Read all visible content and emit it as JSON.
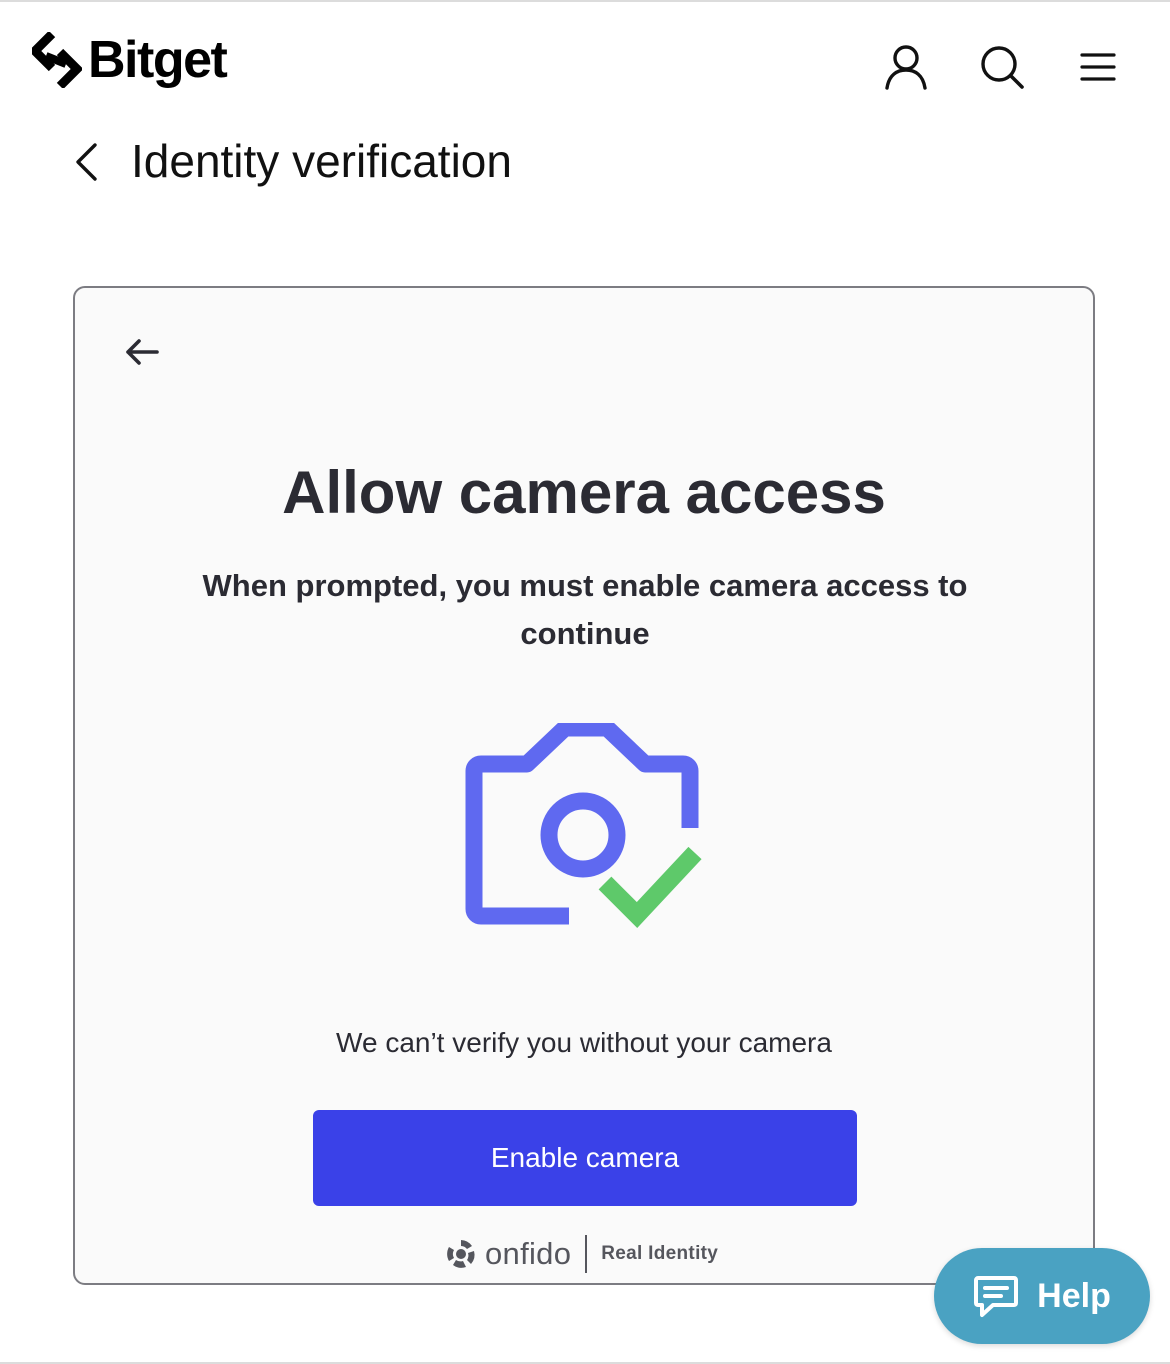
{
  "header": {
    "brand": "Bitget",
    "icons": [
      "user-icon",
      "search-icon",
      "menu-icon"
    ]
  },
  "titlebar": {
    "title": "Identity verification"
  },
  "card": {
    "title": "Allow camera access",
    "subtitle": "When prompted, you must enable camera access to continue",
    "note": "We can’t verify you without your camera",
    "button_label": "Enable camera",
    "colors": {
      "button": "#3a41e8",
      "camera": "#5f69f0",
      "check": "#5ec96a"
    },
    "footer": {
      "brand": "onfido",
      "tagline": "Real Identity"
    }
  },
  "help": {
    "label": "Help",
    "color": "#4aa2c2"
  }
}
